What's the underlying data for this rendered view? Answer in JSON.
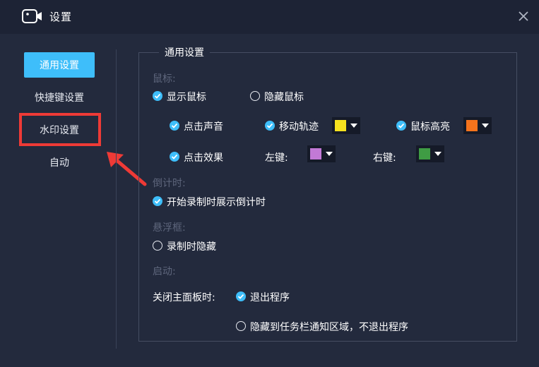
{
  "window": {
    "title": "设置",
    "icons": {
      "app": "camera-icon",
      "close": "close-icon"
    }
  },
  "sidebar": {
    "items": [
      {
        "label": "通用设置",
        "active": true
      },
      {
        "label": "快捷键设置"
      },
      {
        "label": "水印设置"
      },
      {
        "label": "自动"
      }
    ]
  },
  "group": {
    "title": "通用设置",
    "mouse": {
      "section_label": "鼠标:",
      "show_label": "显示鼠标",
      "hide_label": "隐藏鼠标",
      "click_sound_label": "点击声音",
      "trail_label": "移动轨迹",
      "highlight_label": "鼠标高亮",
      "click_effect_label": "点击效果",
      "left_key_label": "左键:",
      "right_key_label": "右键:"
    },
    "countdown": {
      "section_label": "倒计时:",
      "show_label": "开始录制时展示倒计时"
    },
    "floating": {
      "section_label": "悬浮框:",
      "hide_label": "录制时隐藏"
    },
    "startup": {
      "section_label": "启动:",
      "close_label": "关闭主面板时:",
      "exit_label": "退出程序",
      "tray_label": "隐藏到任务栏通知区域，不退出程序"
    }
  },
  "colors": {
    "accent": "#3ebefa",
    "highlight_box": "#ee3a36",
    "trail": "#f7e21e",
    "mouse_highlight": "#f5731c",
    "left_key": "#c279d6",
    "right_key": "#3f9c44"
  }
}
